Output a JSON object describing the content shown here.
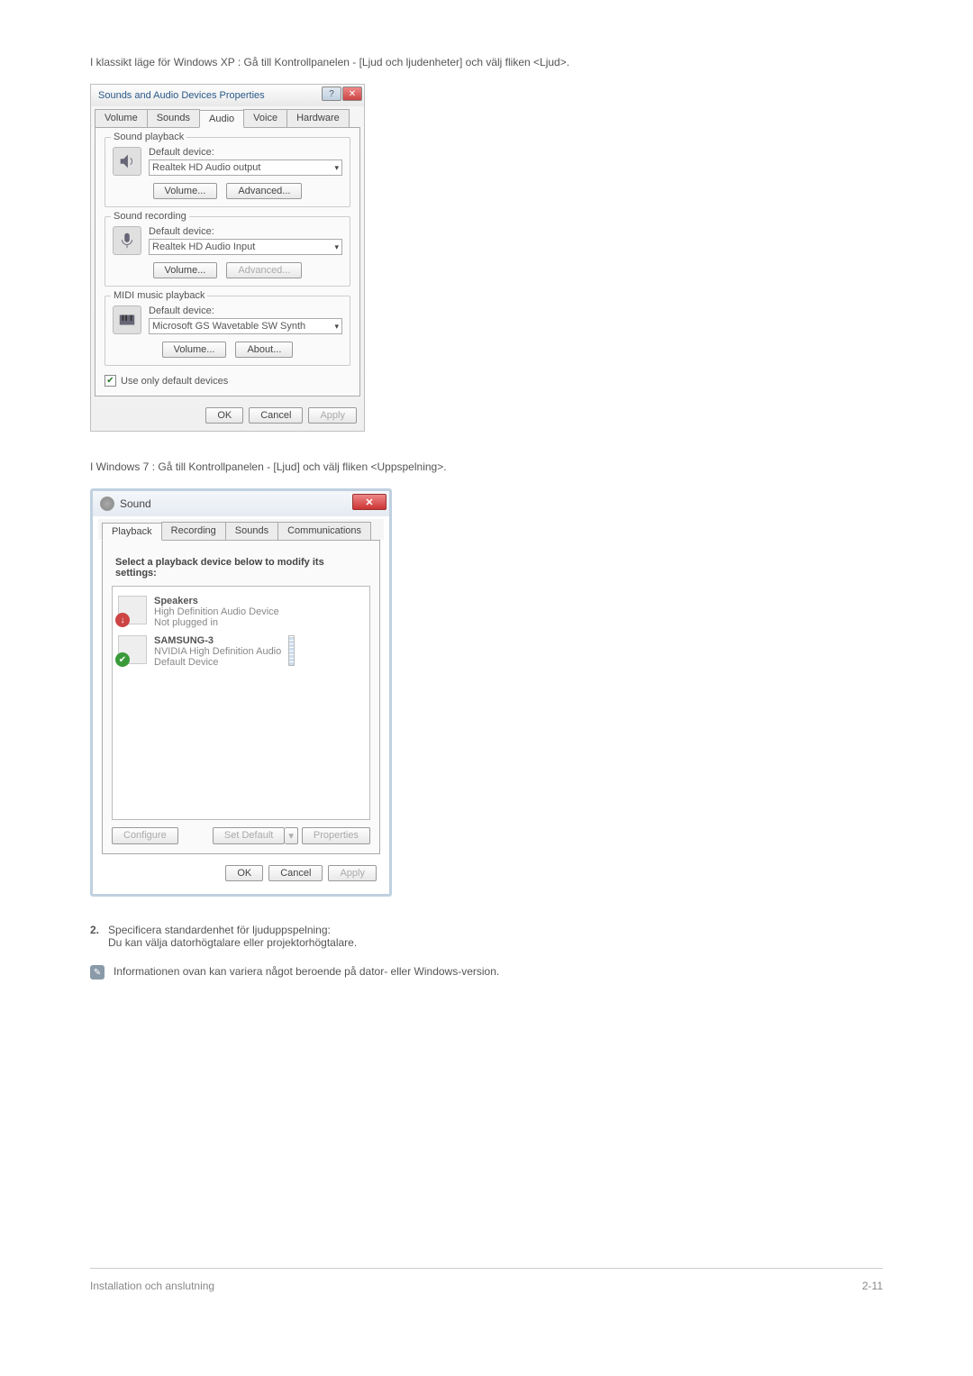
{
  "intro_xp": "I klassikt läge för Windows XP : Gå till Kontrollpanelen - [Ljud och ljudenheter] och välj fliken <Ljud>.",
  "xp": {
    "title": "Sounds and Audio Devices Properties",
    "tabs": [
      "Volume",
      "Sounds",
      "Audio",
      "Voice",
      "Hardware"
    ],
    "playback_legend": "Sound playback",
    "recording_legend": "Sound recording",
    "midi_legend": "MIDI music playback",
    "default_device": "Default device:",
    "playback_device": "Realtek HD Audio output",
    "recording_device": "Realtek HD Audio Input",
    "midi_device": "Microsoft GS Wavetable SW Synth",
    "volume": "Volume...",
    "advanced": "Advanced...",
    "about": "About...",
    "use_default": "Use only default devices",
    "ok": "OK",
    "cancel": "Cancel",
    "apply": "Apply"
  },
  "intro_w7": "I Windows 7 : Gå till Kontrollpanelen - [Ljud] och välj fliken <Uppspelning>.",
  "w7": {
    "title": "Sound",
    "tabs": [
      "Playback",
      "Recording",
      "Sounds",
      "Communications"
    ],
    "instruction": "Select a playback device below to modify its settings:",
    "dev1": {
      "name": "Speakers",
      "sub1": "High Definition Audio Device",
      "sub2": "Not plugged in"
    },
    "dev2": {
      "name": "SAMSUNG-3",
      "sub1": "NVIDIA High Definition Audio",
      "sub2": "Default Device"
    },
    "configure": "Configure",
    "set_default": "Set Default",
    "properties": "Properties",
    "ok": "OK",
    "cancel": "Cancel",
    "apply": "Apply"
  },
  "step2_num": "2.",
  "step2_l1": "Specificera standardenhet för ljuduppspelning:",
  "step2_l2": "Du kan välja datorhögtalare eller projektorhögtalare.",
  "note": "Informationen ovan kan variera något beroende på dator- eller Windows-version.",
  "footer_left": "Installation och anslutning",
  "footer_right": "2-11"
}
